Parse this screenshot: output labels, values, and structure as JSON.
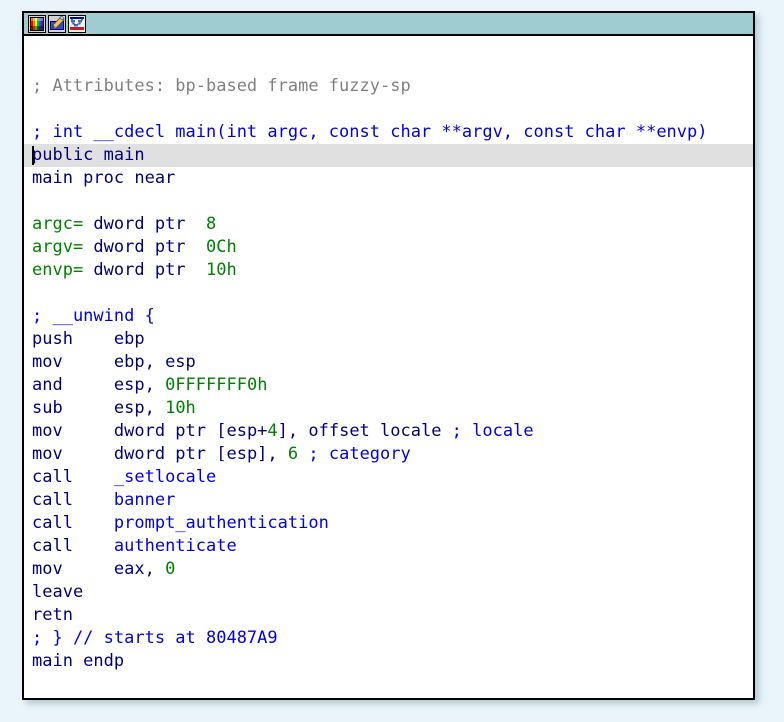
{
  "window": {
    "name": "disassembly-window",
    "background_color": "#ffffff",
    "border_color": "#000000",
    "page_background": "#e9f5fb"
  },
  "toolbar": {
    "background_color": "#9fccd0",
    "buttons": [
      {
        "name": "color-palette-icon",
        "label": "Colors"
      },
      {
        "name": "edit-pencil-icon",
        "label": "Edit"
      },
      {
        "name": "graph-view-icon",
        "label": "Graph view"
      }
    ]
  },
  "colors": {
    "comment_gray": "#808080",
    "comment_blue": "#0000e6",
    "mnemonic": "#00007f",
    "number": "#008000",
    "name": "#008000",
    "function": "#0000e6",
    "highlight_row": "#e0e0e0"
  },
  "disassembly": {
    "name": "main-function-listing",
    "highlighted_line_index": 3,
    "lines": [
      {
        "type": "comment-gray",
        "text": "; Attributes: bp-based frame fuzzy-sp"
      },
      {
        "type": "blank",
        "text": ""
      },
      {
        "type": "comment",
        "text": "; int __cdecl main(int argc, const char **argv, const char **envp)"
      },
      {
        "type": "directive",
        "text": "public main",
        "highlight": true
      },
      {
        "type": "directive",
        "text": "main proc near"
      },
      {
        "type": "blank",
        "text": ""
      },
      {
        "type": "vardef",
        "name": "argc=",
        "keyword": " dword ptr ",
        "value": " 8"
      },
      {
        "type": "vardef",
        "name": "argv=",
        "keyword": " dword ptr ",
        "value": " 0Ch"
      },
      {
        "type": "vardef",
        "name": "envp=",
        "keyword": " dword ptr ",
        "value": " 10h"
      },
      {
        "type": "blank",
        "text": ""
      },
      {
        "type": "comment",
        "text": "; __unwind {"
      },
      {
        "type": "instr",
        "mnemonic": "push",
        "operands": "ebp"
      },
      {
        "type": "instr",
        "mnemonic": "mov",
        "operands": "ebp, esp"
      },
      {
        "type": "instr",
        "mnemonic": "and",
        "operands": "esp, ",
        "number": "0FFFFFFF0h"
      },
      {
        "type": "instr",
        "mnemonic": "sub",
        "operands": "esp, ",
        "number": "10h"
      },
      {
        "type": "instr-mixed",
        "mnemonic": "mov",
        "pre": "dword ptr [esp+",
        "number": "4",
        "post": "], offset locale ",
        "comment": "; locale"
      },
      {
        "type": "instr-mixed",
        "mnemonic": "mov",
        "pre": "dword ptr [esp], ",
        "number": "6",
        "post": " ",
        "comment": "; category"
      },
      {
        "type": "call",
        "mnemonic": "call",
        "target": "_setlocale"
      },
      {
        "type": "call",
        "mnemonic": "call",
        "target": "banner"
      },
      {
        "type": "call",
        "mnemonic": "call",
        "target": "prompt_authentication"
      },
      {
        "type": "call",
        "mnemonic": "call",
        "target": "authenticate"
      },
      {
        "type": "instr",
        "mnemonic": "mov",
        "operands": "eax, ",
        "number": "0"
      },
      {
        "type": "instr",
        "mnemonic": "leave",
        "operands": ""
      },
      {
        "type": "instr",
        "mnemonic": "retn",
        "operands": ""
      },
      {
        "type": "comment",
        "text": "; } // starts at 80487A9"
      },
      {
        "type": "directive",
        "text": "main endp"
      }
    ]
  }
}
